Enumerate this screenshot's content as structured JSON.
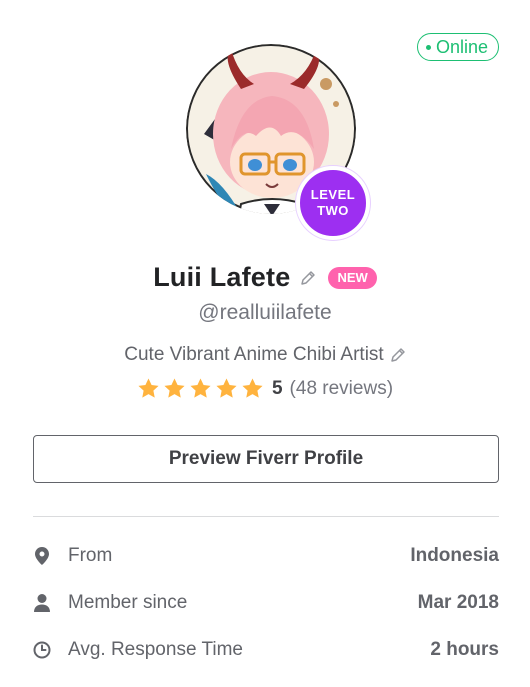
{
  "status": {
    "online_label": "Online",
    "color": "#1dbf73"
  },
  "avatar": {
    "level_line1": "LEVEL",
    "level_line2": "TWO",
    "level_color": "#9d2ff1"
  },
  "profile": {
    "name": "Luii Lafete",
    "new_badge": "NEW",
    "username": "@realluiilafete",
    "tagline": "Cute Vibrant Anime Chibi Artist",
    "rating_value": "5",
    "rating_stars": 5,
    "review_count": "(48 reviews)"
  },
  "actions": {
    "preview_label": "Preview Fiverr Profile"
  },
  "stats": [
    {
      "icon": "location-pin-icon",
      "label": "From",
      "value": "Indonesia"
    },
    {
      "icon": "user-icon",
      "label": "Member since",
      "value": "Mar 2018"
    },
    {
      "icon": "clock-icon",
      "label": "Avg. Response Time",
      "value": "2 hours"
    }
  ],
  "colors": {
    "star": "#ffb33e",
    "new_badge": "#ff62ad"
  }
}
